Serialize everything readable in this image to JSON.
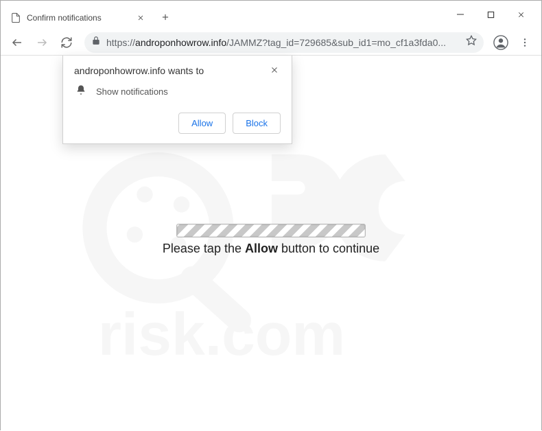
{
  "tab": {
    "title": "Confirm notifications"
  },
  "url": {
    "protocol": "https://",
    "domain": "androponhowrow.info",
    "path": "/JAMMZ?tag_id=729685&sub_id1=mo_cf1a3fda0..."
  },
  "dialog": {
    "title": "androponhowrow.info wants to",
    "permission": "Show notifications",
    "allow": "Allow",
    "block": "Block"
  },
  "page": {
    "prefix": "Please tap the ",
    "strong": "Allow",
    "suffix": " button to continue"
  }
}
